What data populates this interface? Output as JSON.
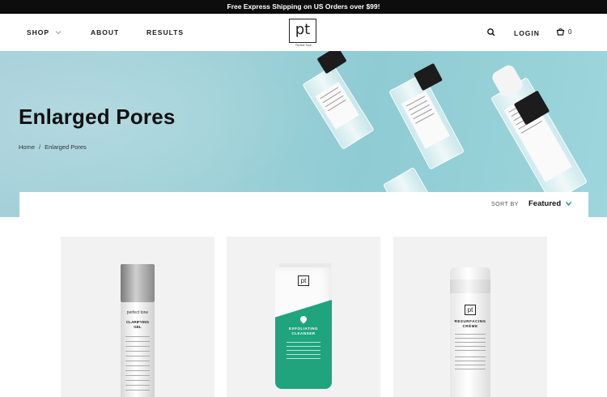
{
  "promo_bar": {
    "text": "Free Express Shipping on US Orders over $99!"
  },
  "header": {
    "nav": [
      {
        "label": "SHOP",
        "has_dropdown": true
      },
      {
        "label": "ABOUT"
      },
      {
        "label": "RESULTS"
      }
    ],
    "logo": {
      "mark": "pt",
      "tagline": "Perfect Tone"
    },
    "search_icon": "search-icon",
    "login_label": "LOGIN",
    "cart": {
      "icon": "cart-icon",
      "count": "0"
    }
  },
  "hero": {
    "title": "Enlarged Pores",
    "breadcrumb": [
      "Home",
      "/",
      "Enlarged Pores"
    ],
    "background_color": "#9fd1d8"
  },
  "sort": {
    "label": "SORT BY",
    "selected": "Featured",
    "accent_color": "#1fa47e"
  },
  "products": [
    {
      "brand": "perfect tone",
      "name_line1": "CLARIFYING",
      "name_line2": "GEL"
    },
    {
      "brand": "pt",
      "name_line1": "EXFOLIATING",
      "name_line2": "CLEANSER",
      "accent_color": "#1fa47e"
    },
    {
      "brand": "pt",
      "name_line1": "RESURFACING",
      "name_line2": "CRÈME"
    }
  ]
}
